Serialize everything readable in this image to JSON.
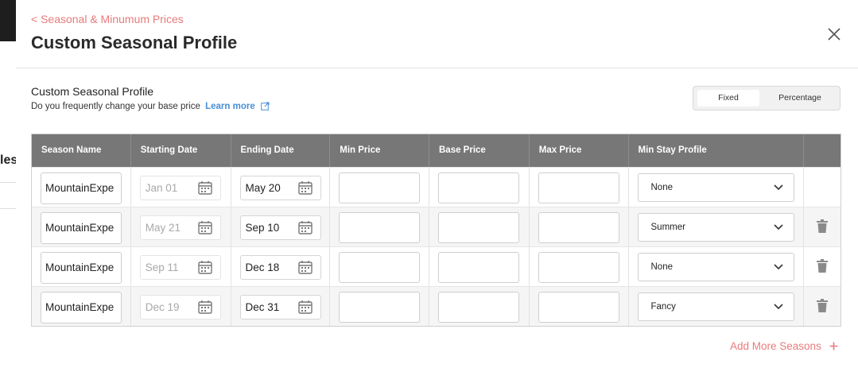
{
  "header": {
    "back_link": "< Seasonal & Minumum Prices",
    "title": "Custom Seasonal Profile"
  },
  "section": {
    "title": "Custom Seasonal Profile",
    "subtitle": "Do you frequently change your base price",
    "learn_more": "Learn more"
  },
  "toggle": {
    "options": [
      "Fixed",
      "Percentage"
    ],
    "selected": "Fixed"
  },
  "table": {
    "columns": [
      "Season Name",
      "Starting Date",
      "Ending Date",
      "Min Price",
      "Base Price",
      "Max Price",
      "Min Stay Profile",
      ""
    ],
    "rows": [
      {
        "name": "MountainExpe",
        "start": "Jan 01",
        "end": "May 20",
        "min_price": "",
        "base_price": "",
        "max_price": "",
        "stay_profile": "None"
      },
      {
        "name": "MountainExpe",
        "start": "May 21",
        "end": "Sep 10",
        "min_price": "",
        "base_price": "",
        "max_price": "",
        "stay_profile": "Summer"
      },
      {
        "name": "MountainExpe",
        "start": "Sep 11",
        "end": "Dec 18",
        "min_price": "",
        "base_price": "",
        "max_price": "",
        "stay_profile": "None"
      },
      {
        "name": "MountainExpe",
        "start": "Dec 19",
        "end": "Dec 31",
        "min_price": "",
        "base_price": "",
        "max_price": "",
        "stay_profile": "Fancy"
      }
    ]
  },
  "add_more": "Add More Seasons",
  "background": {
    "peek_text": "les"
  },
  "colors": {
    "accent": "#e87b7b",
    "link": "#4a8fd6",
    "header_bg": "#777777"
  }
}
